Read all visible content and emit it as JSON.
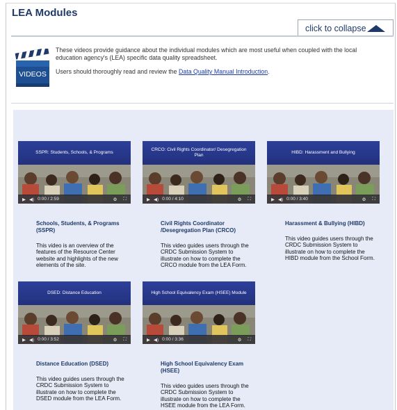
{
  "header": {
    "title": "LEA Modules",
    "collapse_label": "click to collapse"
  },
  "intro": {
    "paragraph1": "These videos provide guidance about the individual modules which are most useful when coupled with the local education agency's (LEA) specific data quality spreadsheet.",
    "paragraph2_prefix": "Users should thoroughly read and review the ",
    "paragraph2_link": "Data Quality Manual Introduction",
    "paragraph2_suffix": ".",
    "icon_label": "VIDEOS"
  },
  "videos": [
    {
      "thumb_title": "SSPR: Students, Schools, & Programs",
      "time": "0:00 / 2:59",
      "title": "Schools, Students, & Programs (SSPR)",
      "description": "This video is an overview of the features of the Resource Center website and highlights of the new elements of the site."
    },
    {
      "thumb_title": "CRCO: Civil Rights Coordinator/ Desegregation Plan",
      "time": "0:00 / 4:10",
      "title": "Civil Rights Coordinator /Desegregation Plan (CRCO)",
      "description": "This video guides users through the CRDC Submission System to illustrate on how to complete the CRCO module from the LEA Form."
    },
    {
      "thumb_title": "HIBD: Harassment and Bullying",
      "time": "0:00 / 3:40",
      "title": "Harassment & Bullying (HIBD)",
      "description": "This video guides users through the CRDC Submission System to illustrate on how to complete the HIBD module from the School Form."
    },
    {
      "thumb_title": "DSED: Distance Education",
      "time": "0:00 / 3:52",
      "title": "Distance Education (DSED)",
      "description": "This video guides users through the CRDC Submission System to illustrate on how to complete the DSED module from the LEA Form."
    },
    {
      "thumb_title": "High School Equivalency Exam (HSEE) Module",
      "time": "0:00 / 3:36",
      "title": "High School Equivalency Exam (HSEE)",
      "description": "This video guides users through the CRDC Submission System to illustrate on how to complete the HSEE module from the LEA Form."
    }
  ],
  "colors": {
    "heading": "#1f3a68",
    "panel": "#e7ebf7",
    "thumb_header": "#2c3f9a",
    "link": "#1a3aa8"
  }
}
